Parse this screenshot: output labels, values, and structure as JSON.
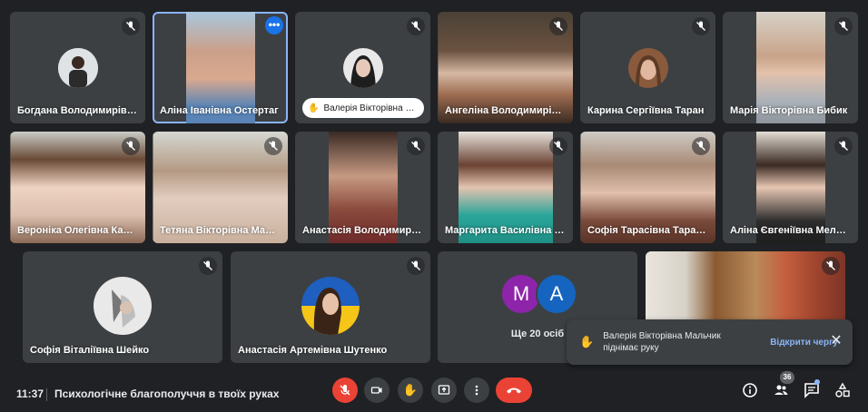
{
  "tiles_row1": [
    {
      "name": "Богдана Володимирівна ...",
      "muted": true
    },
    {
      "name": "Аліна Іванівна Остертаг",
      "muted": false,
      "active": true
    },
    {
      "hand_name": "Валерія Вікторівна Ма...",
      "muted": true
    },
    {
      "name": "Ангеліна Володимирівн...",
      "muted": true
    },
    {
      "name": "Карина Сергіївна Таран",
      "muted": true
    },
    {
      "name": "Марія Вікторівна Бибик",
      "muted": true
    }
  ],
  "tiles_row2": [
    {
      "name": "Вероніка Олегівна Кацан",
      "muted": true
    },
    {
      "name": "Тетяна Вікторівна Марте...",
      "muted": true
    },
    {
      "name": "Анастасія Володимирів...",
      "muted": true
    },
    {
      "name": "Маргарита Василівна Во...",
      "muted": true
    },
    {
      "name": "Софія Тарасівна Тарасова",
      "muted": true
    },
    {
      "name": "Аліна Євгеніївна Мельник",
      "muted": true
    }
  ],
  "tiles_row3": [
    {
      "name": "Софія Віталіївна Шейко",
      "muted": true
    },
    {
      "name": "Анастасія Артемівна Шутенко",
      "muted": true
    },
    {
      "more_label": "Ще 20 осіб",
      "letters": [
        "M",
        "A"
      ],
      "letter_colors": [
        "#8e24aa",
        "#1565c0"
      ]
    },
    {
      "muted": true
    }
  ],
  "notification": {
    "text": "Валерія Вікторівна Мальчик піднімає руку",
    "action": "Відкрити чергу",
    "close": "✕"
  },
  "bottom_bar": {
    "time": "11:37",
    "meeting_title": "Психологічне благополуччя в твоїх руках",
    "people_count": "36"
  },
  "colors": {
    "background": "#202124",
    "tile": "#3c4043",
    "accent": "#8ab4f8",
    "danger": "#ea4335",
    "active_border": "#8ab4f8"
  }
}
